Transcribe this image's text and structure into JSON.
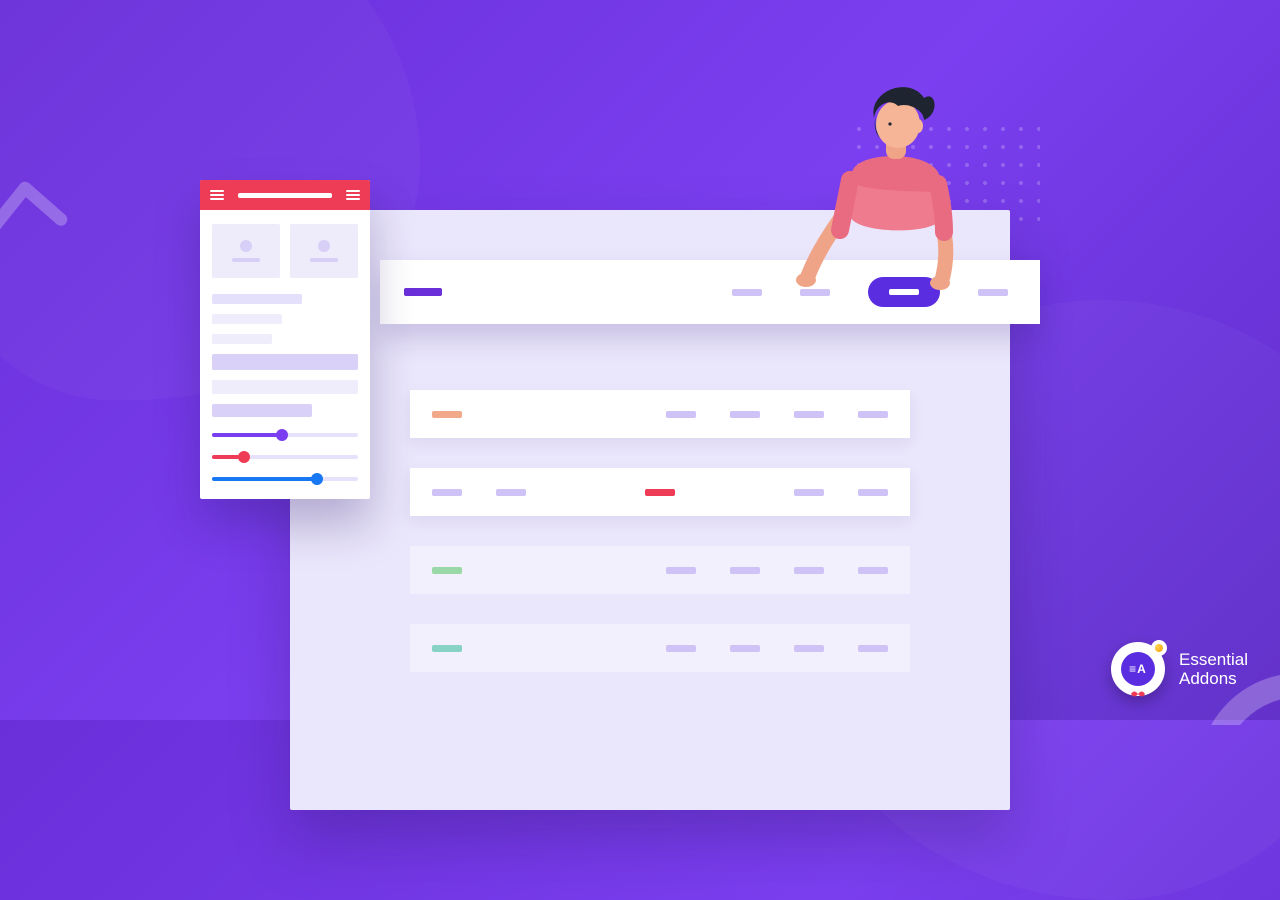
{
  "brand": {
    "line1": "Essential",
    "line2": "Addons",
    "badge_label": "≡A"
  },
  "colors": {
    "accent_purple": "#6a2fd9",
    "accent_red": "#ee3c56",
    "accent_blue": "#1877f2",
    "canvas_bg": "#eae6fb"
  },
  "sidebar": {
    "sliders": [
      {
        "color": "purple",
        "value": 48
      },
      {
        "color": "red",
        "value": 22
      },
      {
        "color": "blue",
        "value": 72
      }
    ]
  },
  "hero_nav": {
    "link_count": 3,
    "active_index": 3
  },
  "rows": [
    {
      "lead_color": "orange",
      "cells": 4
    },
    {
      "lead_color": "purple_double_then_red_centered",
      "cells": 5
    },
    {
      "lead_color": "green",
      "cells": 5,
      "ghost": true
    },
    {
      "lead_color": "teal",
      "cells": 5,
      "ghost": true
    }
  ]
}
